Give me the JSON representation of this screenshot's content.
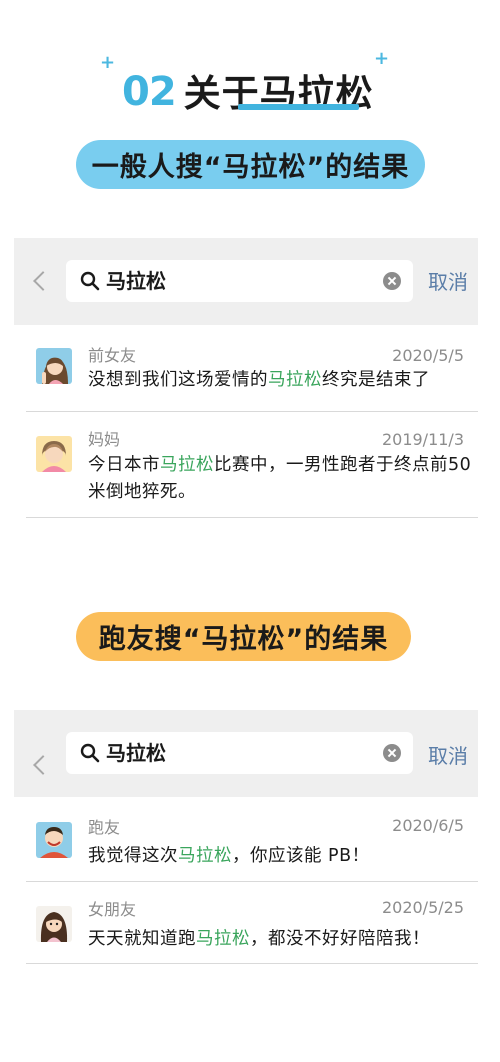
{
  "header": {
    "number": "02",
    "title_prefix": "关于",
    "title_highlight": "马拉松",
    "accent": "#41b4df"
  },
  "sections": [
    {
      "pill_label": "一般人搜“马拉松”的结果",
      "pill_color": "#79cdef",
      "search": {
        "query": "马拉松",
        "cancel": "取消"
      },
      "results": [
        {
          "sender": "前女友",
          "date": "2020/5/5",
          "before": "没想到我们这场爱情的",
          "keyword": "马拉松",
          "after": "终究是结束了",
          "avatar": "ex-girlfriend-avatar"
        },
        {
          "sender": "妈妈",
          "date": "2019/11/3",
          "before": "今日本市",
          "keyword": "马拉松",
          "after": "比赛中，一男性跑者于终点前50 米倒地猝死。",
          "avatar": "mom-avatar"
        }
      ]
    },
    {
      "pill_label": "跑友搜“马拉松”的结果",
      "pill_color": "#fbbe5a",
      "search": {
        "query": "马拉松",
        "cancel": "取消"
      },
      "results": [
        {
          "sender": "跑友",
          "date": "2020/6/5",
          "before": "我觉得这次",
          "keyword": "马拉松",
          "after": "，你应该能 PB！",
          "avatar": "runner-friend-avatar"
        },
        {
          "sender": "女朋友",
          "date": "2020/5/25",
          "before": "天天就知道跑",
          "keyword": "马拉松",
          "after": "，都没不好好陪陪我！",
          "avatar": "girlfriend-avatar"
        }
      ]
    }
  ],
  "colors": {
    "keyword_highlight": "#3aa55c",
    "cancel_link": "#5a7da8",
    "panel_bg": "#efefef"
  }
}
